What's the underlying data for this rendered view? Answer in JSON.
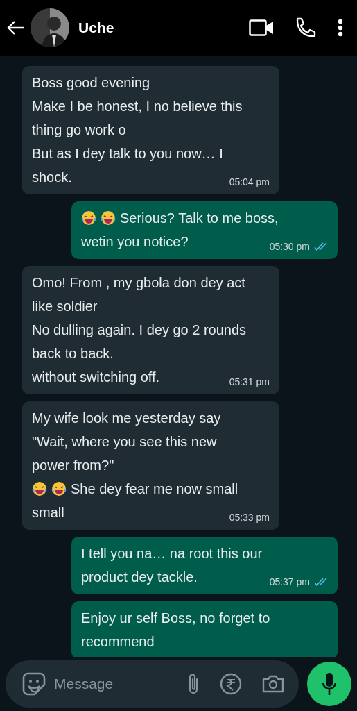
{
  "header": {
    "contact_name": "Uche"
  },
  "messages": [
    {
      "kind": "incoming",
      "lines": [
        {
          "text": "Boss good evening"
        },
        {
          "text": "Make I be honest, I no believe this"
        },
        {
          "text": "thing go work o"
        },
        {
          "text": "But as I dey talk to you now… I"
        },
        {
          "text": "shock."
        }
      ],
      "time": "05:04 pm"
    },
    {
      "kind": "outgoing",
      "lines": [
        {
          "emoji": [
            {
              "kind": "laughing"
            },
            {
              "kind": "laughing"
            }
          ],
          "text": "Serious? Talk to me boss,"
        },
        {
          "text": "wetin you notice?"
        }
      ],
      "time": "05:30 pm",
      "read": true
    },
    {
      "kind": "incoming",
      "lines": [
        {
          "text": "Omo! From , my gbola don dey act"
        },
        {
          "text": "like soldier"
        },
        {
          "text": "No dulling again. I dey go 2 rounds"
        },
        {
          "text": "back to back."
        },
        {
          "text": "without switching off."
        }
      ],
      "time": "05:31 pm"
    },
    {
      "kind": "incoming",
      "lines": [
        {
          "text": "My wife look me yesterday say"
        },
        {
          "text": "\"Wait, where you see this new"
        },
        {
          "text": "power from?\""
        },
        {
          "emoji": [
            {
              "kind": "laughing"
            },
            {
              "kind": "laughing"
            }
          ],
          "text": "She dey fear me now small"
        },
        {
          "text": "small"
        }
      ],
      "time": "05:33 pm"
    },
    {
      "kind": "outgoing",
      "lines": [
        {
          "text": "I tell you na… na root this our"
        },
        {
          "text": "product dey tackle."
        }
      ],
      "time": "05:37 pm",
      "read": true
    },
    {
      "kind": "outgoing",
      "lines": [
        {
          "text": "Enjoy ur self Boss, no forget to"
        },
        {
          "text": "recommend"
        }
      ]
    }
  ],
  "composer": {
    "placeholder": "Message"
  }
}
